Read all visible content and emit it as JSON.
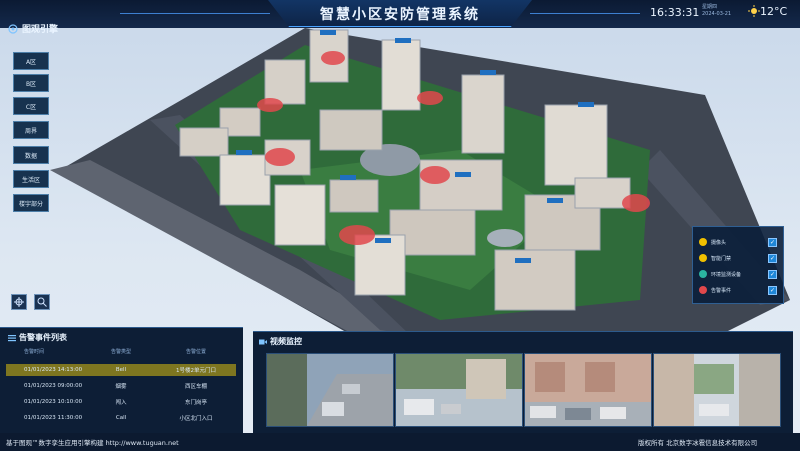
{
  "header": {
    "title": "智慧小区安防管理系统",
    "time": "16:33:31",
    "date_caption": "星期四",
    "date": "2024-03-21",
    "temperature": "12°C",
    "weather_icon": "sun-icon"
  },
  "nav": {
    "title": "图观引擎",
    "items": [
      "A区",
      "B区",
      "C区",
      "周界",
      "数据",
      "生活区",
      "楼宇部分"
    ]
  },
  "legend": {
    "items": [
      {
        "label": "摄像头",
        "color": "#f0c000",
        "checked": true
      },
      {
        "label": "智能门禁",
        "color": "#f0c000",
        "checked": true
      },
      {
        "label": "环境监测设备",
        "color": "#2bb3a0",
        "checked": true
      },
      {
        "label": "告警事件",
        "color": "#e0484c",
        "checked": true
      }
    ]
  },
  "events": {
    "title": "告警事件列表",
    "columns": [
      "告警时间",
      "告警类型",
      "告警位置"
    ],
    "rows": [
      {
        "time": "01/01/2023 14:13:00",
        "type": "Bell",
        "place": "1号楼2单元门口"
      },
      {
        "time": "01/01/2023 09:00:00",
        "type": "烟雾",
        "place": "西区车棚"
      },
      {
        "time": "01/01/2023 10:10:00",
        "type": "闯入",
        "place": "东门岗亭"
      },
      {
        "time": "01/01/2023 11:30:00",
        "type": "Call",
        "place": "小区北门入口"
      }
    ]
  },
  "video": {
    "title": "视频监控"
  },
  "footer": {
    "left": "基于图观™数字孪生应用引擎构建 http://www.tuguan.net",
    "right": "版权所有 北京数字冰雹信息技术有限公司"
  },
  "colors": {
    "accent": "#1f87d8",
    "panel": "#0d1e36",
    "alert": "#e0484c",
    "selected_row": "#7e7620"
  }
}
